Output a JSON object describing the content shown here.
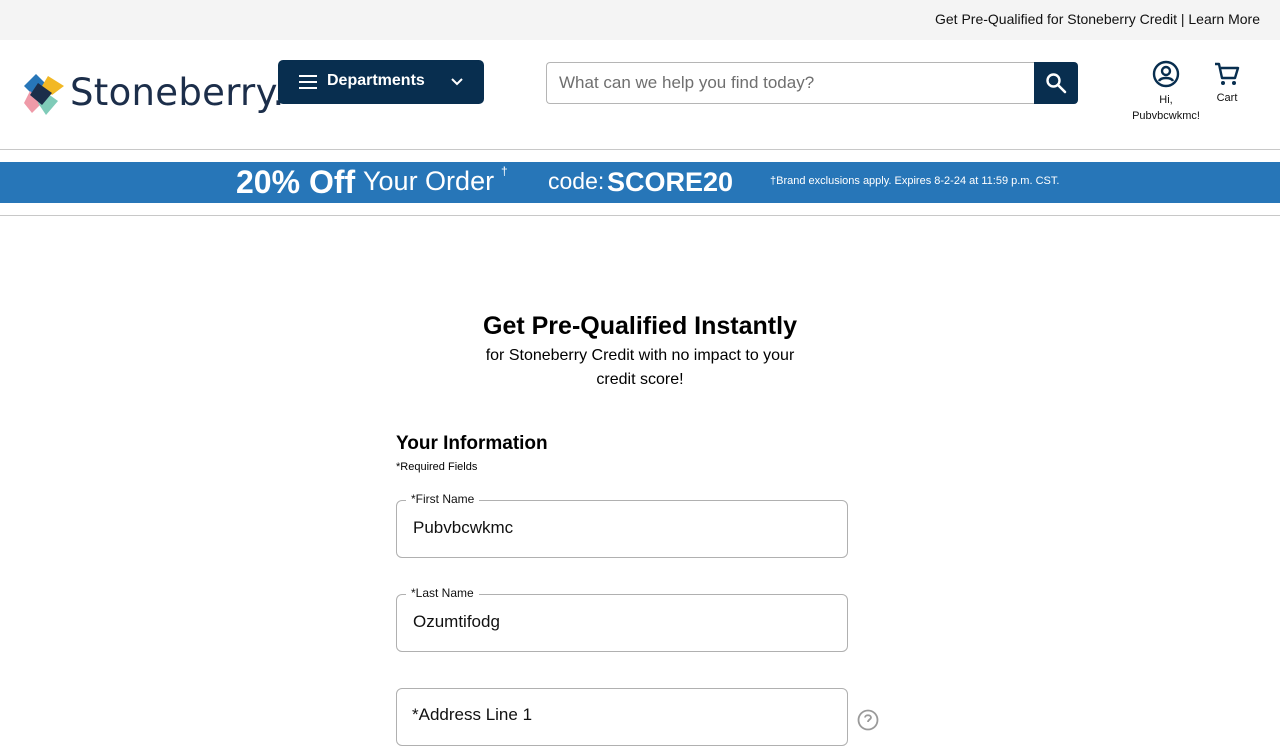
{
  "topbar": {
    "promo_link": "Get Pre-Qualified for Stoneberry Credit | Learn More"
  },
  "header": {
    "logo_text": "Stoneberry",
    "logo_dot": ".",
    "departments_label": "Departments",
    "search_placeholder": "What can we help you find today?",
    "account_line1": "Hi,",
    "account_line2": "Pubvbcwkmc!",
    "cart_label": "Cart"
  },
  "banner": {
    "discount": "20% Off",
    "order_text": "Your Order",
    "dagger": "†",
    "code_label": "code:",
    "code": "SCORE20",
    "fine_print": "†Brand exclusions apply. Expires 8-2-24 at 11:59 p.m. CST."
  },
  "hero": {
    "title": "Get Pre-Qualified Instantly",
    "subtitle": "for Stoneberry Credit with no impact to your credit score!"
  },
  "form": {
    "section_title": "Your Information",
    "required_note": "*Required Fields",
    "first_name": {
      "label": "*First Name",
      "value": "Pubvbcwkmc"
    },
    "last_name": {
      "label": "*Last Name",
      "value": "Ozumtifodg"
    },
    "address1": {
      "placeholder": "*Address Line 1"
    }
  },
  "colors": {
    "navy": "#082e4f",
    "banner_blue": "#2776b8",
    "logo_text": "#1c2e4a"
  }
}
